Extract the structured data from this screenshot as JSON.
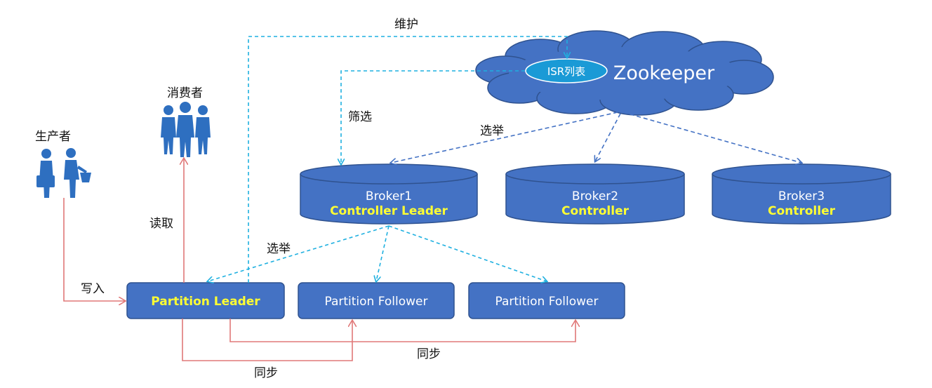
{
  "zookeeper": {
    "title": "Zookeeper",
    "isr_label": "ISR列表"
  },
  "brokers": [
    {
      "name": "Broker1",
      "role": "Controller Leader"
    },
    {
      "name": "Broker2",
      "role": "Controller"
    },
    {
      "name": "Broker3",
      "role": "Controller"
    }
  ],
  "partitions": {
    "leader": "Partition Leader",
    "follower1": "Partition Follower",
    "follower2": "Partition Follower"
  },
  "actors": {
    "producer": "生产者",
    "consumer": "消费者"
  },
  "edges": {
    "maintain": "维护",
    "filter": "筛选",
    "elect_brokers": "选举",
    "elect_partitions": "选举",
    "read": "读取",
    "write": "写入",
    "sync1": "同步",
    "sync2": "同步"
  },
  "colors": {
    "box_fill": "#4472c4",
    "box_border": "#2f528f",
    "cyan_dashed": "#1fb0e0",
    "blue_dashed": "#4472c4",
    "red_arrow": "#e07878",
    "highlight_text": "#ffff33"
  }
}
